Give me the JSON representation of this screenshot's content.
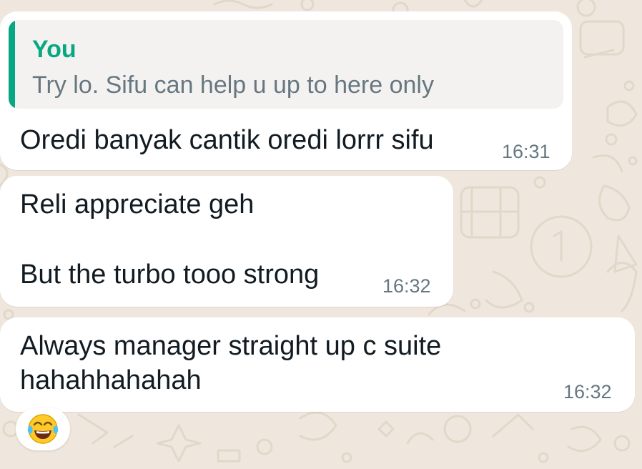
{
  "colors": {
    "chat_background": "#efe7dd",
    "bubble": "#ffffff",
    "quote_accent": "#06a884",
    "timestamp": "#667781"
  },
  "messages": [
    {
      "quote": {
        "author": "You",
        "text": "Try lo. Sifu can help u up to here only"
      },
      "text": "Oredi banyak cantik oredi lorrr sifu",
      "time": "16:31"
    },
    {
      "line1": "Reli appreciate geh",
      "line2": "But the turbo tooo strong",
      "time": "16:32"
    },
    {
      "line1": "Always manager straight up c suite",
      "line2": "hahahhahahah",
      "time": "16:32"
    }
  ],
  "reaction": {
    "emoji": "😂",
    "icon": "face-with-tears-of-joy-icon"
  }
}
